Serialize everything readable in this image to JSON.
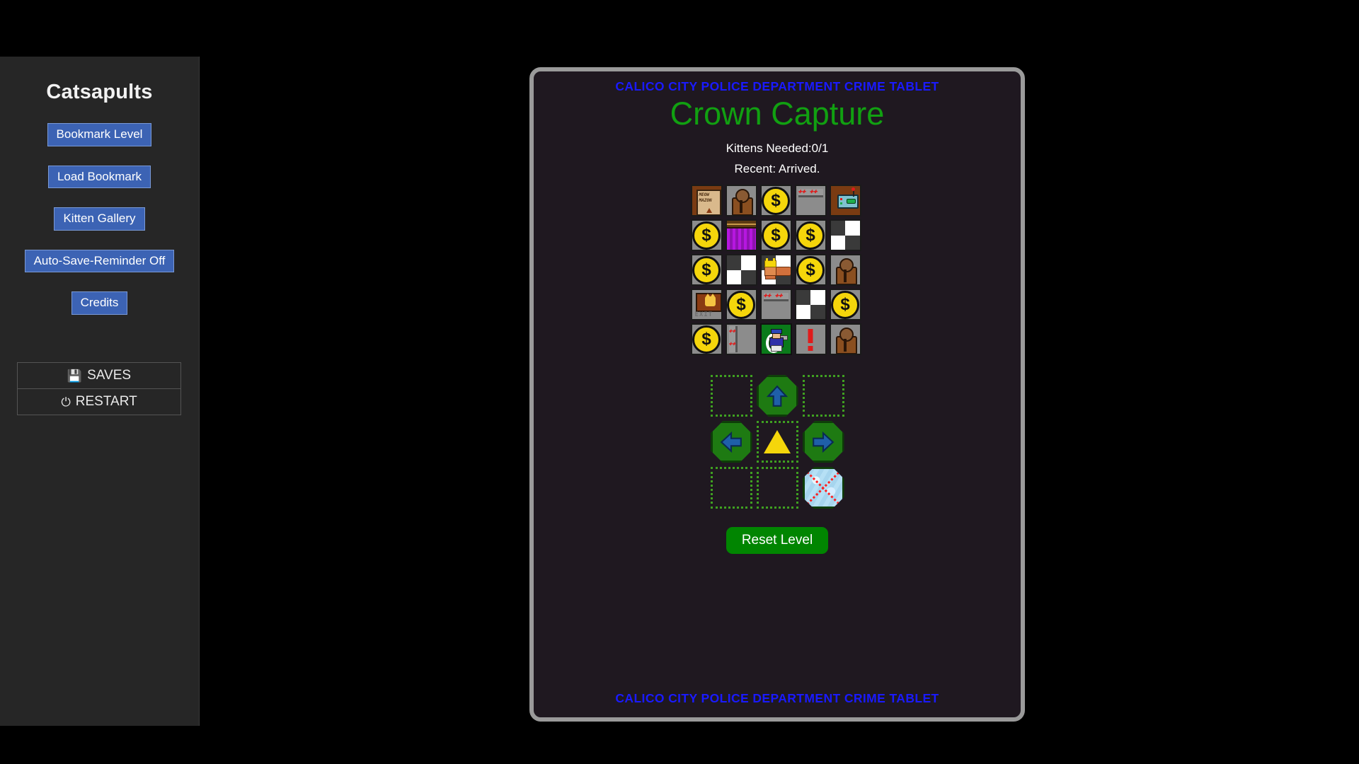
{
  "sidebar": {
    "title": "Catsapults",
    "buttons": [
      {
        "label": "Bookmark Level",
        "name": "bookmark-level"
      },
      {
        "label": "Load Bookmark",
        "name": "load-bookmark"
      },
      {
        "label": "Kitten Gallery",
        "name": "kitten-gallery"
      },
      {
        "label": "Auto-Save-Reminder Off",
        "name": "auto-save-reminder"
      },
      {
        "label": "Credits",
        "name": "credits"
      }
    ],
    "menu": [
      {
        "label": "SAVES",
        "icon": "floppy-disk-icon",
        "glyph": "💾"
      },
      {
        "label": "RESTART",
        "icon": "power-icon",
        "glyph": "⏻"
      }
    ]
  },
  "tablet": {
    "banner_top": "CALICO CITY POLICE DEPARTMENT CRIME TABLET",
    "banner_bottom": "CALICO CITY POLICE DEPARTMENT CRIME TABLET",
    "level_title": "Crown Capture",
    "kittens_needed": "Kittens Needed:0/1",
    "recent": "Recent: Arrived.",
    "reset_label": "Reset Level",
    "colors": {
      "banner": "#1a1aff",
      "title": "#11a011",
      "reset_button": "#018501",
      "tablet_bg": "#1f1820",
      "tablet_border": "#9a9a9a"
    }
  },
  "grid": {
    "rows": 5,
    "cols": 5,
    "cells": [
      {
        "name": "tile-delivery-box",
        "kind": "box",
        "bg": "brown",
        "text1": "MEOW",
        "text2": "MAZON"
      },
      {
        "name": "tile-statue",
        "kind": "statue",
        "bg": "grey"
      },
      {
        "name": "tile-coin",
        "kind": "coin",
        "bg": "grey",
        "symbol": "$"
      },
      {
        "name": "tile-sign-horizontal",
        "kind": "sign-h",
        "bg": "grey",
        "marks": "✚✚   ✚✚"
      },
      {
        "name": "tile-console",
        "kind": "console",
        "bg": "brown"
      },
      {
        "name": "tile-coin",
        "kind": "coin",
        "bg": "grey",
        "symbol": "$"
      },
      {
        "name": "tile-curtain",
        "kind": "curtain",
        "bg": "purple"
      },
      {
        "name": "tile-coin",
        "kind": "coin",
        "bg": "grey",
        "symbol": "$"
      },
      {
        "name": "tile-coin",
        "kind": "coin",
        "bg": "grey",
        "symbol": "$"
      },
      {
        "name": "tile-checkerboard",
        "kind": "check",
        "bg": "check"
      },
      {
        "name": "tile-coin",
        "kind": "coin",
        "bg": "grey",
        "symbol": "$"
      },
      {
        "name": "tile-checkerboard",
        "kind": "check",
        "bg": "check"
      },
      {
        "name": "tile-crowned-cat",
        "kind": "kingcat",
        "bg": "check"
      },
      {
        "name": "tile-coin",
        "kind": "coin",
        "bg": "grey",
        "symbol": "$"
      },
      {
        "name": "tile-statue",
        "kind": "statue",
        "bg": "grey"
      },
      {
        "name": "tile-exit-sign",
        "kind": "exit",
        "bg": "grey",
        "label": "EXIT"
      },
      {
        "name": "tile-coin",
        "kind": "coin",
        "bg": "grey",
        "symbol": "$"
      },
      {
        "name": "tile-sign-horizontal",
        "kind": "sign-h",
        "bg": "grey",
        "marks": "✚✚   ✚✚"
      },
      {
        "name": "tile-checkerboard",
        "kind": "check",
        "bg": "check"
      },
      {
        "name": "tile-coin",
        "kind": "coin",
        "bg": "grey",
        "symbol": "$"
      },
      {
        "name": "tile-coin",
        "kind": "coin",
        "bg": "grey",
        "symbol": "$"
      },
      {
        "name": "tile-sign-vertical",
        "kind": "sign-v",
        "bg": "grey",
        "marks": "✚✚"
      },
      {
        "name": "tile-police-officer",
        "kind": "officer",
        "bg": "green"
      },
      {
        "name": "tile-alert",
        "kind": "exclaim",
        "bg": "grey"
      },
      {
        "name": "tile-statue",
        "kind": "statue",
        "bg": "grey"
      }
    ]
  },
  "controls": [
    {
      "name": "control-slot-empty",
      "kind": "empty"
    },
    {
      "name": "control-move-up",
      "kind": "arrow",
      "direction": "up"
    },
    {
      "name": "control-slot-empty",
      "kind": "empty"
    },
    {
      "name": "control-move-left",
      "kind": "arrow",
      "direction": "left"
    },
    {
      "name": "control-launch",
      "kind": "triangle"
    },
    {
      "name": "control-move-right",
      "kind": "arrow",
      "direction": "right"
    },
    {
      "name": "control-slot-empty",
      "kind": "empty"
    },
    {
      "name": "control-slot-empty",
      "kind": "empty"
    },
    {
      "name": "control-ice-disabled",
      "kind": "ice"
    }
  ]
}
